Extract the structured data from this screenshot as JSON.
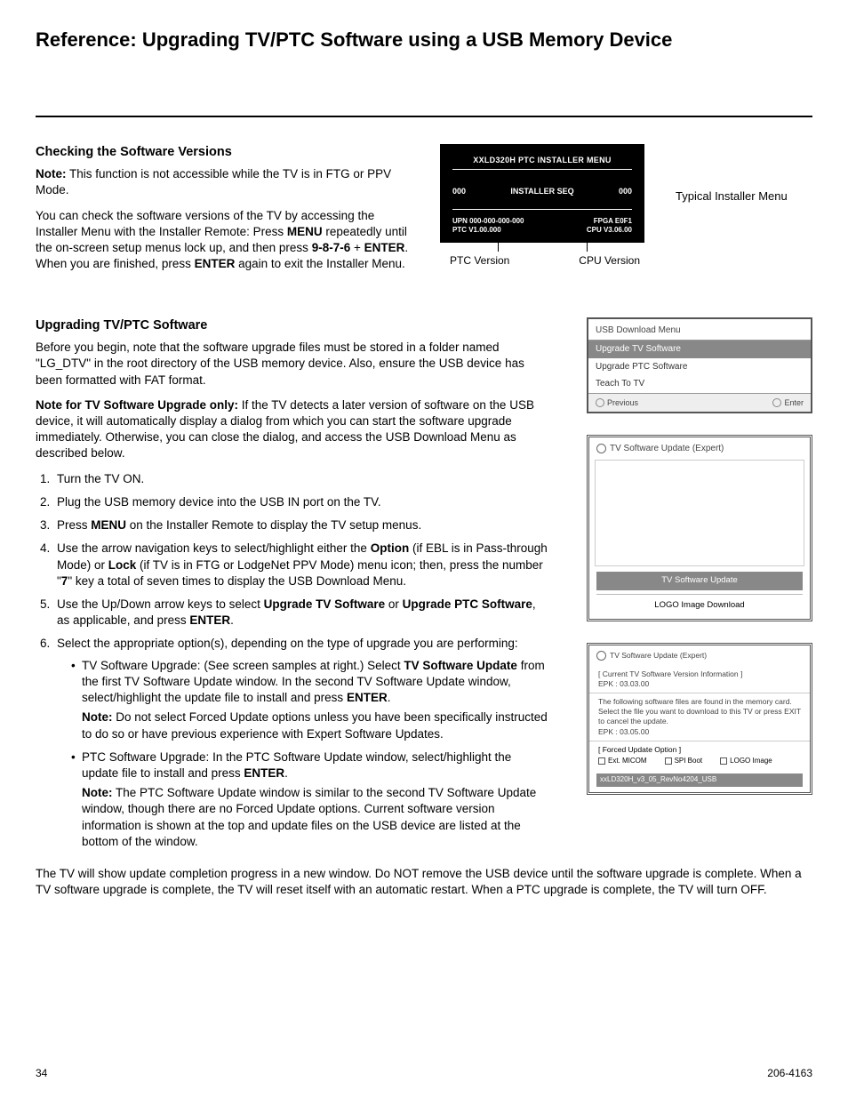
{
  "page_title": "Reference: Upgrading TV/PTC Software using a USB Memory Device",
  "section1": {
    "heading": "Checking the Software Versions",
    "note_label": "Note:",
    "note_text": " This function is not accessible while the TV is in FTG or PPV Mode.",
    "para_a": "You can check the software versions of the TV by accessing the Installer Menu with the Installer Remote: Press ",
    "menu": "MENU",
    "para_b": " repeatedly until the on-screen setup menus lock up, and then press ",
    "combo": "9-8-7-6",
    "para_c": " + ",
    "enter1": "ENTER",
    "para_d": ". When you are finished, press ",
    "enter2": "ENTER",
    "para_e": " again to exit the Installer Menu."
  },
  "installer": {
    "title": "XXLD320H PTC INSTALLER MENU",
    "left1": "000",
    "mid1": "INSTALLER SEQ",
    "right1": "000",
    "upn": "UPN   000-000-000-000",
    "ptc": "PTC V1.00.000",
    "fpga": "FPGA E0F1",
    "cpu": "CPU V3.06.00",
    "label_ptc": "PTC Version",
    "label_cpu": "CPU Version",
    "caption": "Typical Installer Menu"
  },
  "section2": {
    "heading": "Upgrading TV/PTC Software",
    "intro": "Before you begin, note that the software upgrade ﬁles must be stored in a folder named \"LG_DTV\" in the root directory of the USB memory device. Also, ensure the USB device has been formatted with FAT format.",
    "note2_label": "Note for TV Software Upgrade only:",
    "note2_text": " If the TV detects a later version of software on the USB device, it will automatically display a dialog from which you can start the software upgrade immediately. Otherwise, you can close the dialog, and access the USB Download Menu as described below.",
    "steps": {
      "s1": "Turn the TV ON.",
      "s2": "Plug the USB memory device into the USB IN port on the TV.",
      "s3a": "Press ",
      "s3b": "MENU",
      "s3c": " on the Installer Remote to display the TV setup menus.",
      "s4a": "Use the arrow navigation keys to select/highlight either the ",
      "s4b": "Option",
      "s4c": " (if EBL is in Pass-through Mode) or ",
      "s4d": "Lock",
      "s4e": " (if TV is in FTG or LodgeNet PPV Mode) menu icon; then, press the number \"",
      "s4f": "7",
      "s4g": "\" key a total of seven times to display the USB Download Menu.",
      "s5a": "Use the Up/Down arrow keys to select ",
      "s5b": "Upgrade TV Software",
      "s5c": " or ",
      "s5d": "Upgrade PTC Software",
      "s5e": ", as applicable, and press ",
      "s5f": "ENTER",
      "s5g": ".",
      "s6": "Select the appropriate option(s), depending on the type of upgrade you are performing:",
      "b1a": "TV Software Upgrade: (See screen samples at right.) Select ",
      "b1b": "TV Software Update",
      "b1c": " from the ﬁrst TV Software Update window. In the second TV Software Update window, select/highlight the update ﬁle to install and press ",
      "b1d": "ENTER",
      "b1e": ".",
      "b1note_label": "Note:",
      "b1note": " Do not select Forced Update options unless you have been speciﬁcally instructed to do so or have previous experience with Expert Software Updates.",
      "b2a": "PTC Software Upgrade: In the PTC Software Update window, select/highlight the update ﬁle to install and press ",
      "b2b": "ENTER",
      "b2c": ".",
      "b2note_label": "Note:",
      "b2note": " The PTC Software Update window is similar to the second TV Software Update window, though there are no Forced Update options. Current software version information is shown at the top and update ﬁles on the USB device are listed at the bottom of the window."
    },
    "closing": "The TV will show update completion progress in a new window. Do NOT remove the USB device until the software upgrade is complete. When a TV software upgrade is complete, the TV will reset itself with an automatic restart. When a PTC upgrade is complete, the TV will turn OFF."
  },
  "usb_menu": {
    "title": "USB Download Menu",
    "r1": "Upgrade TV Software",
    "r2": "Upgrade PTC Software",
    "r3": "Teach To TV",
    "prev": "Previous",
    "enter": "Enter"
  },
  "expert1": {
    "title": "TV Software Update (Expert)",
    "btn1": "TV Software Update",
    "btn2": "LOGO Image Download"
  },
  "expert2": {
    "title": "TV Software Update (Expert)",
    "sec1_t": "[ Current TV Software Version Information ]",
    "sec1_v": "EPK : 03.03.00",
    "sec2_t": "The following software files are found in the memory card. Select the file you want to download to this TV or press EXIT to cancel the update.",
    "sec2_v": "EPK : 03.05.00",
    "opt_t": "[ Forced Update Option ]",
    "c1": "Ext. MICOM",
    "c2": "SPI Boot",
    "c3": "LOGO Image",
    "file": "xxLD320H_v3_05_RevNo4204_USB"
  },
  "footer": {
    "left": "34",
    "right": "206-4163"
  }
}
